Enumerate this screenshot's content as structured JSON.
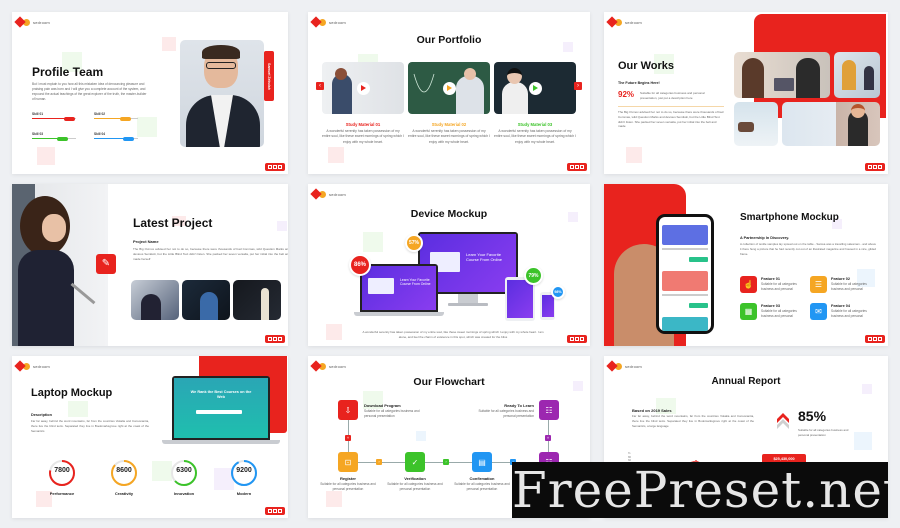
{
  "brand": {
    "logo_text": "sedroom",
    "accent": "#e8231e",
    "orange": "#f5a623",
    "green": "#3cc32a",
    "blue": "#2196f3",
    "purple": "#9c27b0"
  },
  "watermark": "FreePreset.net",
  "slides": {
    "profile_team": {
      "title": "Profile Team",
      "body": "But I must explain to you how all this mistaken idea of denouncing pleasure and praising pain was born and I will give you a complete account of the system, and expound the actual teachings of the great explorer of the truth, the master-builder of human.",
      "name_badge": "Samuel Zebulah",
      "skills": [
        {
          "label": "Skill 01",
          "level": 0.85,
          "color": "#e8231e"
        },
        {
          "label": "Skill 02",
          "level": 0.7,
          "color": "#f5a623"
        },
        {
          "label": "Skill 03",
          "level": 0.6,
          "color": "#3cc32a"
        },
        {
          "label": "Skill 04",
          "level": 0.75,
          "color": "#2196f3"
        }
      ]
    },
    "our_portfolio": {
      "title": "Our Portfolio",
      "cards": [
        {
          "title": "Study Material 01",
          "color": "#e8231e",
          "text": "A wonderful serenity has taken possession of my entire soul, like these sweet mornings of spring which I enjoy with my whole heart."
        },
        {
          "title": "Study Material 02",
          "color": "#f5a623",
          "text": "A wonderful serenity has taken possession of my entire soul, like these sweet mornings of spring which I enjoy with my whole heart."
        },
        {
          "title": "Study Material 03",
          "color": "#3cc32a",
          "text": "A wonderful serenity has taken possession of my entire soul, like these sweet mornings of spring which I enjoy with my whole heart."
        }
      ],
      "prev": "‹",
      "next": "›"
    },
    "our_works": {
      "title": "Our Works",
      "subtitle": "The Future Begins Here!",
      "stat": "92%",
      "stat_desc": "Suitable for all categories business and personal presentation, just put a description here",
      "body": "The Big Oxmox advised her not to do so, because there were thousands of bad Commas, wild Question Marks and devious Semikoli, but the Little Blind Text didn't listen. She packed her seven versalia, put her initial into the belt and made"
    },
    "latest_project": {
      "title": "Latest Project",
      "subtitle": "Project Name",
      "body": "The Big Oxmox advised her not to do so, because there were thousands of bad Commas, wild Question Marks and devious Semikoli, but the Little Blind Text didn't listen. She packed her seven versalia, put her initial into the belt and made herself"
    },
    "device_mockup": {
      "title": "Device Mockup",
      "screen_headline": "Learn Your Favorite Course From Online",
      "badges": [
        {
          "value": "86%",
          "color": "#e8231e"
        },
        {
          "value": "57%",
          "color": "#f5a623"
        },
        {
          "value": "79%",
          "color": "#3cc32a"
        },
        {
          "value": "98%",
          "color": "#2196f3"
        }
      ],
      "body": "A wonderful serenity has taken possession of my entire soul, like these sweet mornings of spring which I enjoy with my whole heart. I am alone, and feel the charm of existence in this spot, which was created for the bliss"
    },
    "smartphone_mockup": {
      "title": "Smartphone Mockup",
      "subtitle": "A Partnership In Discovery.",
      "body": "A collection of textile samples lay spread out on the table - Samsa was a travelling salesman - and above it there hung a picture that he had recently cut out of an illustrated magazine and housed in a nice, gilded frame.",
      "features": [
        {
          "title": "Feature 01",
          "desc": "Suitable for all categories business and personal",
          "color": "#e8231e",
          "icon": "☝"
        },
        {
          "title": "Feature 02",
          "desc": "Suitable for all categories business and personal",
          "color": "#f5a623",
          "icon": "☰"
        },
        {
          "title": "Feature 03",
          "desc": "Suitable for all categories business and personal",
          "color": "#3cc32a",
          "icon": "▦"
        },
        {
          "title": "Feature 04",
          "desc": "Suitable for all categories business and personal",
          "color": "#2196f3",
          "icon": "✉"
        }
      ]
    },
    "laptop_mockup": {
      "title": "Laptop Mockup",
      "subtitle": "Description",
      "body": "Far far away, behind the word mountains, far from the countries Vokalia and Consonantia, there live the blind texts. Separated they live in Bookmarksgrove right at the coast of the Semantics",
      "screen_headline": "We Rank the Best Courses on the Web",
      "stats": [
        {
          "value": "7800",
          "label": "Performance",
          "color": "#e8231e",
          "fraction": 0.78
        },
        {
          "value": "8600",
          "label": "Creativity",
          "color": "#f5a623",
          "fraction": 0.86
        },
        {
          "value": "6300",
          "label": "Innovation",
          "color": "#3cc32a",
          "fraction": 0.63
        },
        {
          "value": "9200",
          "label": "Modern",
          "color": "#2196f3",
          "fraction": 0.92
        }
      ]
    },
    "our_flowchart": {
      "title": "Our Flowchart",
      "steps": [
        {
          "title": "Download Program",
          "desc": "Suitable for all categories business and personal presentation",
          "color": "#e8231e"
        },
        {
          "title": "Register",
          "desc": "Suitable for all categories business and personal presentation",
          "color": "#f5a623"
        },
        {
          "title": "Verification",
          "desc": "Suitable for all categories business and personal presentation",
          "color": "#3cc32a"
        },
        {
          "title": "Confirmation",
          "desc": "Suitable for all categories business and personal presentation",
          "color": "#2196f3"
        },
        {
          "title": "Ready To Learn",
          "desc": "Suitable for all categories business and personal presentation",
          "color": "#9c27b0"
        }
      ]
    },
    "annual_report": {
      "title": "Annual Report",
      "subtitle": "Based on 2019 Sales",
      "body": "Far far away, behind the word mountains, far from the countries Vokalia and Consonantia, there live the blind texts. Separated they live in Bookmarksgrove right at the coast of the Semantics, a large language",
      "stat": "85%",
      "stat_desc": "Suitable for all categories business and personal presentation",
      "callout": "$25,430,000",
      "axis_labels": [
        "%",
        "80",
        "60"
      ]
    }
  }
}
